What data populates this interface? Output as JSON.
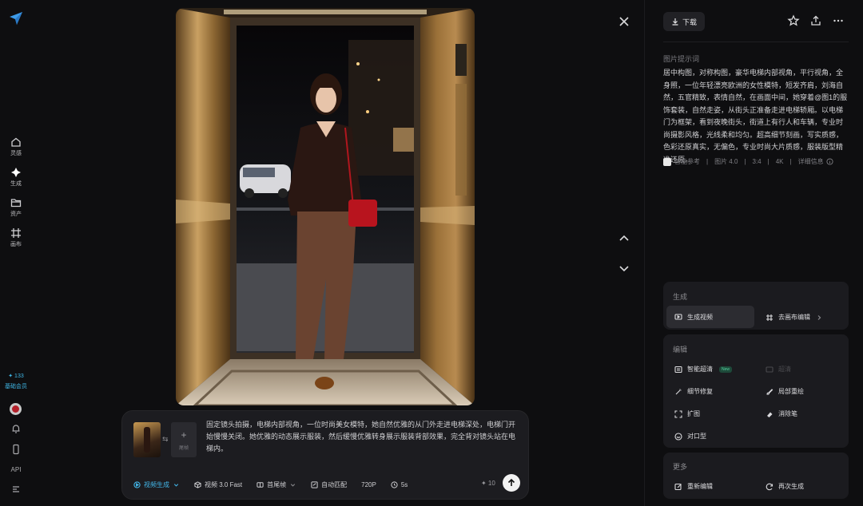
{
  "sidebar": {
    "logo_icon": "paper-plane-logo",
    "items": [
      {
        "label": "灵感",
        "icon": "home-icon"
      },
      {
        "label": "生成",
        "icon": "sparkle-icon"
      },
      {
        "label": "资产",
        "icon": "folder-icon"
      },
      {
        "label": "画布",
        "icon": "canvas-icon"
      }
    ],
    "credits": "✦ 133",
    "membership": "基础会员",
    "api_label": "API"
  },
  "viewer": {
    "image_alt": "elevator fashion photo"
  },
  "prompt_box": {
    "swap_symbol": "⇆",
    "tail_frame_label": "尾帧",
    "text": "固定镜头拍摄，电梯内部视角，一位时尚美女模特，她自然优雅的从门外走进电梯深处，电梯门开始慢慢关闭。她优雅的动态展示服装，然后缓慢优雅转身展示服装背部效果，完全背对镜头站在电梯内。",
    "toolbar": {
      "mode": "视频生成",
      "model": "视频 3.0 Fast",
      "frames": "首尾帧",
      "ratio": "自动匹配",
      "resolution": "720P",
      "duration": "5s"
    },
    "cost": "✦ 10"
  },
  "panel": {
    "download_label": "下载",
    "section_label": "图片提示词",
    "description": "居中构图，对称构图，豪华电梯内部视角，平行视角，全身照，一位年轻漂亮欧洲的女性模特，短发齐肩，刘海自然，五官精致，表情自然，在画面中间，她穿着@图1的服饰套装，自然走姿，从街头正准备走进电梯轿厢。以电梯门为框架，看到夜晚街头，街道上有行人和车辆，专业时尚摄影风格，光线柔和均匀。超高细节刻画，写实质感，色彩还原真实，无偏色，专业时尚大片质感，服装版型精准还原。",
    "meta": {
      "reference": "智能参考",
      "model": "图片 4.0",
      "ratio": "3:4",
      "quality": "4K",
      "details": "详细信息"
    },
    "generate_card": {
      "title": "生成",
      "generate_video": "生成视频",
      "canvas_edit": "去画布编辑"
    },
    "edit_card": {
      "title": "编辑",
      "smart_upscale": "智能超清",
      "smart_upscale_badge": "New",
      "upscale": "超清",
      "detail_repair": "细节修复",
      "partial_redraw": "局部重绘",
      "expand": "扩图",
      "eraser": "消除笔",
      "lip_sync": "对口型"
    },
    "more_card": {
      "title": "更多",
      "re_edit": "重新编辑",
      "regenerate": "再次生成"
    }
  }
}
